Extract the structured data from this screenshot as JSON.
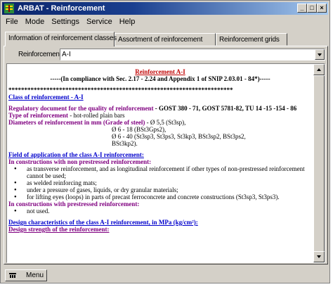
{
  "window": {
    "title": "ARBAT - Reinforcement",
    "buttons": {
      "minimize": "_",
      "maximize": "□",
      "close": "×"
    }
  },
  "menubar": {
    "items": [
      "File",
      "Mode",
      "Settings",
      "Service",
      "Help"
    ]
  },
  "tabs": [
    {
      "label": "Information of reinforcement classes",
      "active": true
    },
    {
      "label": "Assortment of reinforcement",
      "active": false
    },
    {
      "label": "Reinforcement grids",
      "active": false
    }
  ],
  "selector": {
    "label": "Reinforcement",
    "value": "A-I"
  },
  "document": {
    "title": "Reinforcement A-I",
    "subtitle": "-----(In compliance with Sec. 2.17 - 2.24 and Appendix 1 of SNIP 2.03.01 - 84*)-----",
    "separator": "***********************************************************************",
    "class_heading": "Class of reinforcement - A-I",
    "regulatory_label": "Regulatory document for the quality of reinforcement",
    "regulatory_value": " - GOST 380 - 71, GOST 5781-82, TU 14 -15 -154 - 86",
    "type_label": "Type of reinforcement",
    "type_value": " - hot-rolled plain bars",
    "diameters_label": "Diameters of reinforcement in mm (Grade of steel)",
    "diameters_1": " - Ø 5,5 (St3sp),",
    "diameters_2": "Ø 6 - 18 (BSt3Gps2),",
    "diameters_3": "Ø 6 - 40 (St3sp3, St3ps3, St3kp3, BSt3sp2, BSt3ps2,",
    "diameters_4": "BSt3kp2).",
    "field_heading": "Field of application of the class A-I reinforcement:",
    "non_prestressed_heading": "In constructions with non prestressed reinforcement:",
    "non_prestressed_items": [
      "as transverse reinforcement, and as longitudinal reinforcement if other types of non-prestressed reinforcement cannot be used;",
      "as welded reinforcing mats;",
      "under a pressure of gases, liquids, or dry granular materials;",
      "for lifting eyes (loops) in parts of precast ferroconcrete and concrete constructions (St3sp3, St3ps3)."
    ],
    "prestressed_heading": "In constructions with prestressed reinforcement:",
    "prestressed_items": [
      "not used."
    ],
    "design_heading": "Design characteristics of the class A-I reinforcement, in MPa (kg/cm²):",
    "design_strength": "Design strength of the reinforcement:"
  },
  "statusbar": {
    "menu_button": "Menu"
  },
  "colors": {
    "title_gradient_start": "#0a246a",
    "accent_red": "#c00000",
    "accent_purple": "#800080",
    "accent_blue": "#0000cc",
    "face": "#d4d0c8"
  }
}
